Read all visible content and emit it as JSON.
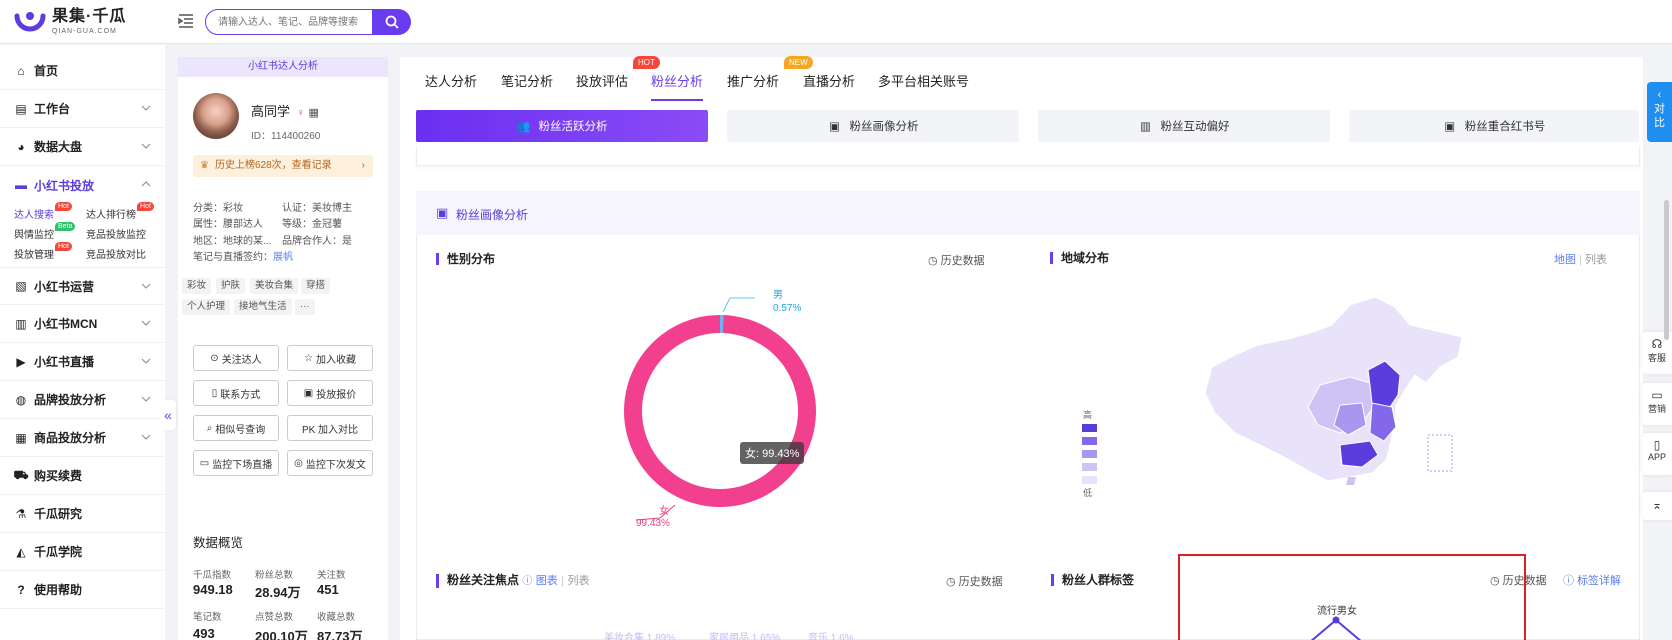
{
  "brand": {
    "name": "果集·千瓜",
    "sub": "QIAN-GUA.COM",
    "color": "#5b3cdc"
  },
  "search": {
    "placeholder": "请输入达人、笔记、品牌等搜索"
  },
  "sidebar": {
    "items": [
      {
        "label": "首页",
        "icon": "home-icon"
      },
      {
        "label": "工作台",
        "icon": "dashboard-icon"
      },
      {
        "label": "数据大盘",
        "icon": "pie-icon"
      },
      {
        "label": "小红书投放",
        "icon": "folder-icon"
      },
      {
        "label": "小红书运营",
        "icon": "chart-icon"
      },
      {
        "label": "小红书MCN",
        "icon": "building-icon"
      },
      {
        "label": "小红书直播",
        "icon": "video-icon"
      },
      {
        "label": "品牌投放分析",
        "icon": "bag-icon"
      },
      {
        "label": "商品投放分析",
        "icon": "box-icon"
      },
      {
        "label": "购买续费",
        "icon": "cart-icon"
      },
      {
        "label": "千瓜研究",
        "icon": "flask-icon"
      },
      {
        "label": "千瓜学院",
        "icon": "cap-icon"
      },
      {
        "label": "使用帮助",
        "icon": "help-icon"
      }
    ],
    "subitems": [
      {
        "label": "达人搜索",
        "badge": "Hot"
      },
      {
        "label": "达人排行榜",
        "badge": "Hot"
      },
      {
        "label": "舆情监控",
        "badge": "Beta"
      },
      {
        "label": "竞品投放监控",
        "badge": ""
      },
      {
        "label": "投放管理",
        "badge": "Hot"
      },
      {
        "label": "竞品投放对比",
        "badge": ""
      }
    ]
  },
  "profile": {
    "panel_title": "小红书达人分析",
    "name": "高同学",
    "id": "ID：114400260",
    "history": "历史上榜628次，查看记录",
    "fields": [
      "分类：彩妆",
      "认证：美妆博主",
      "属性：腰部达人",
      "等级：金冠薯",
      "地区：地球的某...",
      "品牌合作人：是"
    ],
    "sign_label": "笔记与直播签约：",
    "sign_link": "展帆",
    "tags": [
      "彩妆",
      "护肤",
      "美妆合集",
      "穿搭",
      "个人护理",
      "接地气生活",
      "···"
    ],
    "buttons": [
      {
        "label": "关注达人",
        "icon": "⊙"
      },
      {
        "label": "加入收藏",
        "icon": "☆"
      },
      {
        "label": "联系方式",
        "icon": "▯"
      },
      {
        "label": "投放报价",
        "icon": "▣"
      },
      {
        "label": "相似号查询",
        "icon": "⌕"
      },
      {
        "label": "PK 加入对比",
        "icon": ""
      },
      {
        "label": "监控下场直播",
        "icon": "▭"
      },
      {
        "label": "监控下次发文",
        "icon": "◎"
      }
    ],
    "overview_title": "数据概览",
    "stats": [
      {
        "label": "千瓜指数",
        "value": "949.18"
      },
      {
        "label": "粉丝总数",
        "value": "28.94万"
      },
      {
        "label": "关注数",
        "value": "451"
      },
      {
        "label": "笔记数",
        "value": "493"
      },
      {
        "label": "点赞总数",
        "value": "200.10万"
      },
      {
        "label": "收藏总数",
        "value": "87.73万"
      }
    ]
  },
  "tabs": [
    {
      "label": "达人分析",
      "badge": ""
    },
    {
      "label": "笔记分析",
      "badge": ""
    },
    {
      "label": "投放评估",
      "badge": "HOT"
    },
    {
      "label": "粉丝分析",
      "badge": ""
    },
    {
      "label": "推广分析",
      "badge": "NEW"
    },
    {
      "label": "直播分析",
      "badge": ""
    },
    {
      "label": "多平台相关账号",
      "badge": ""
    }
  ],
  "subtabs": [
    "粉丝活跃分析",
    "粉丝画像分析",
    "粉丝互动偏好",
    "粉丝重合红书号"
  ],
  "card": {
    "title": "粉丝画像分析",
    "gender": {
      "title": "性别分布",
      "history": "历史数据",
      "male_label": "男",
      "male_value": "0.57%",
      "female_label": "女",
      "female_value": "99.43%",
      "tooltip": "女: 99.43%"
    },
    "region": {
      "title": "地域分布",
      "view_map": "地图",
      "view_list": "列表",
      "legend_high": "高",
      "legend_low": "低",
      "colors": [
        "#5b3cdc",
        "#8468ea",
        "#a996ef",
        "#cfc3f6",
        "#e9e3fa"
      ]
    },
    "focus": {
      "title": "粉丝关注焦点",
      "view_chart": "图表",
      "view_list": "列表",
      "history": "历史数据",
      "words": [
        "美妆合集 1.89%",
        "家居用品 1.65%",
        "音乐 1.6%"
      ]
    },
    "crowd": {
      "title": "粉丝人群标签",
      "history": "历史数据",
      "detail": "标签详解",
      "radar_label": "流行男女"
    }
  },
  "chart_data": {
    "type": "pie",
    "categories": [
      "男",
      "女"
    ],
    "values": [
      0.57,
      99.43
    ],
    "title": "性别分布"
  },
  "float": {
    "compare": "对比",
    "service": "客服",
    "marketing": "营销",
    "app": "APP"
  }
}
